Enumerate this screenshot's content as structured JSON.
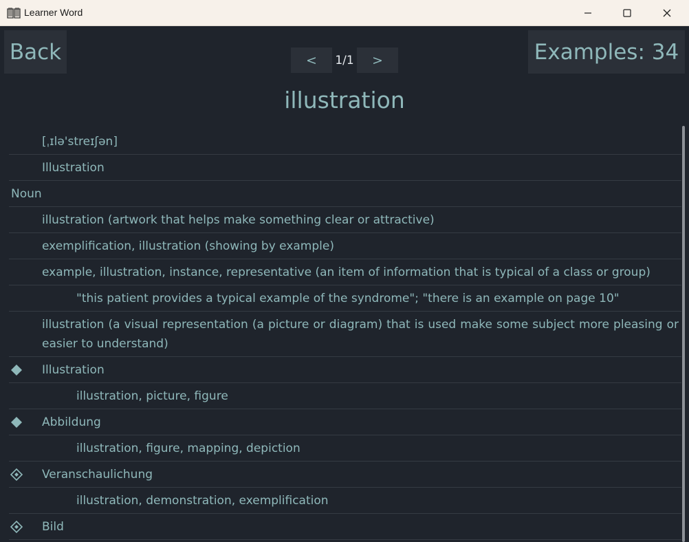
{
  "window": {
    "title": "Learner Word"
  },
  "toolbar": {
    "back_label": "Back",
    "examples_label": "Examples: 34",
    "prev_label": "<",
    "next_label": ">",
    "page_label": "1/1"
  },
  "word": "illustration",
  "entries": [
    {
      "text": "[ˌɪlə'streɪʃən]"
    },
    {
      "text": "Illustration"
    },
    {
      "text": "Noun"
    },
    {
      "text": "illustration (artwork that helps make something clear or attractive)"
    },
    {
      "text": "exemplification, illustration (showing by example)"
    },
    {
      "text": "example, illustration, instance, representative (an item of information that is typical of a class or group)"
    },
    {
      "text": "\"this patient provides a typical example of the syndrome\"; \"there is an example on page 10\""
    },
    {
      "text": "illustration (a visual representation (a picture or diagram) that is used make some subject more pleasing or easier to understand)"
    },
    {
      "text": "Illustration"
    },
    {
      "text": "illustration, picture, figure"
    },
    {
      "text": "Abbildung"
    },
    {
      "text": "illustration, figure, mapping, depiction"
    },
    {
      "text": "Veranschaulichung"
    },
    {
      "text": "illustration, demonstration, exemplification"
    },
    {
      "text": "Bild"
    }
  ],
  "colors": {
    "background": "#1f242c",
    "accent_text": "#8fb8ba",
    "button_bg": "#2b3038",
    "titlebar_bg": "#f7f1ea"
  }
}
